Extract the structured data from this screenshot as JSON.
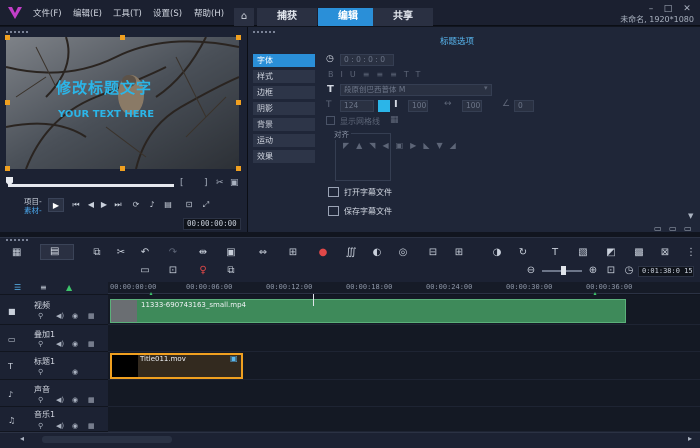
{
  "menu": {
    "items": [
      "文件(F)",
      "编辑(E)",
      "工具(T)",
      "设置(S)",
      "帮助(H)"
    ]
  },
  "tabs": {
    "home_icon": "home-icon",
    "items": [
      {
        "label": "捕获",
        "active": false
      },
      {
        "label": "编辑",
        "active": true
      },
      {
        "label": "共享",
        "active": false
      }
    ]
  },
  "project": {
    "info": "未命名, 1920*1080"
  },
  "preview": {
    "title_main": "修改标题文字",
    "title_sub": "YOUR TEXT HERE",
    "bracket_left": "[",
    "bracket_right": "]",
    "mode_project": "项目-",
    "mode_clip": "素材-",
    "timecode": "00:00:00:00"
  },
  "options": {
    "header": "标题选项",
    "tabs": [
      "字体",
      "样式",
      "边框",
      "阴影",
      "背景",
      "运动",
      "效果"
    ],
    "active_tab": "字体",
    "duration": "0 : 0 : 0 : 0",
    "font_name": "段原创巴西普体 M",
    "font_size": "124",
    "line_spacing": "100",
    "kerning": "100",
    "rotation": "0",
    "show_grid": "显示网格线",
    "alignment_label": "对齐",
    "open_subtitle": "打开字幕文件",
    "save_subtitle": "保存字幕文件"
  },
  "timeline": {
    "ruler": [
      "00:00:00:00",
      "00:00:06:00",
      "00:00:12:00",
      "00:00:18:00",
      "00:00:24:00",
      "00:00:30:00",
      "00:00:36:00"
    ],
    "zoom_time": "0:01:38:0 15",
    "tracks": [
      {
        "name": "视频",
        "icon": "video-track-icon"
      },
      {
        "name": "叠加1",
        "icon": "overlay-track-icon"
      },
      {
        "name": "标题1",
        "icon": "title-track-icon"
      },
      {
        "name": "声音",
        "icon": "voice-track-icon"
      },
      {
        "name": "音乐1",
        "icon": "music-track-icon"
      }
    ],
    "video_clip": "11333-690743163_small.mp4",
    "title_clip": "Title011.mov"
  },
  "colors": {
    "accent": "#2a8fd8",
    "title_text": "#2bb5e8",
    "selection": "#f0a020",
    "video_clip": "#3e8a5a",
    "background": "#11151f"
  }
}
